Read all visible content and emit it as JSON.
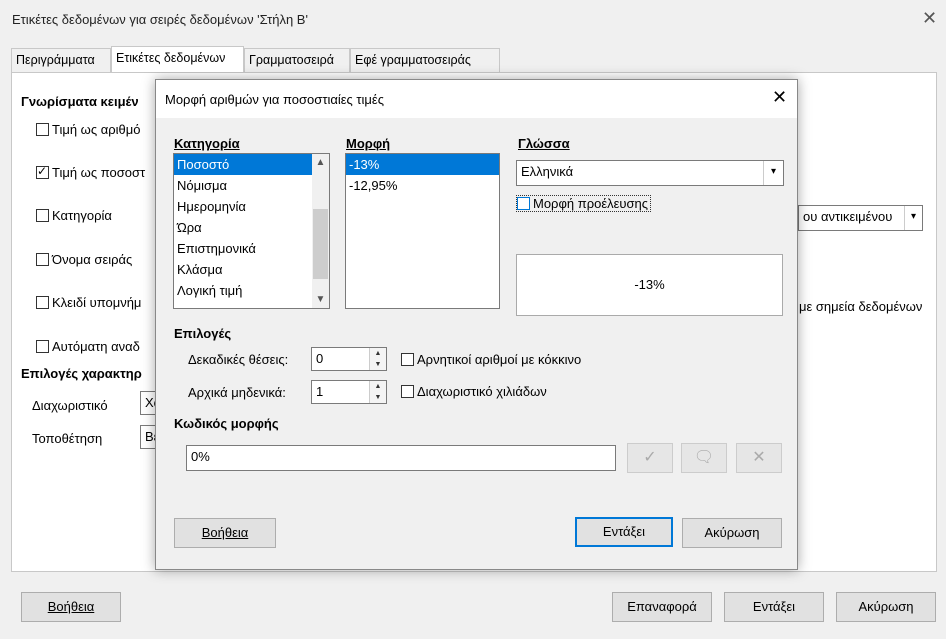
{
  "outer": {
    "title": "Ετικέτες δεδομένων για σειρές δεδομένων 'Στήλη Β'",
    "tabs": [
      "Περιγράμματα",
      "Ετικέτες δεδομένων",
      "Γραμματοσειρά",
      "Εφέ γραμματοσειράς"
    ],
    "section_text_attrs": "Γνωρίσματα κειμέν",
    "checkboxes": [
      {
        "label": "Τιμή ως αριθμό",
        "checked": false
      },
      {
        "label": "Τιμή ως ποσοστ",
        "checked": true
      },
      {
        "label": "Κατηγορία",
        "checked": false
      },
      {
        "label": "Όνομα σειράς",
        "checked": false
      },
      {
        "label": "Κλειδί υπομνήμ",
        "checked": false
      },
      {
        "label": "Αυτόματη αναδ",
        "checked": false
      }
    ],
    "section_text_options": "Επιλογές χαρακτηρ",
    "separator_label": "Διαχωριστικό",
    "separator_value": "Χώ",
    "placement_label": "Τοποθέτηση",
    "placement_value": "Bέ",
    "rotate_value": "ου αντικειμένου",
    "right_text": "με σημεία δεδομένων",
    "buttons": {
      "help": "Βοήθεια",
      "reset": "Επαναφορά",
      "ok": "Εντάξει",
      "cancel": "Ακύρωση"
    }
  },
  "inner": {
    "title": "Μορφή αριθμών για ποσοστιαίες τιμές",
    "category_header": "Κατηγορία",
    "categories": [
      "Ποσοστό",
      "Νόμισμα",
      "Ημερομηνία",
      "Ώρα",
      "Επιστημονικά",
      "Κλάσμα",
      "Λογική τιμή"
    ],
    "format_header": "Μορφή",
    "formats": [
      "-13%",
      "-12,95%"
    ],
    "language_header": "Γλώσσα",
    "language_value": "Ελληνικά",
    "source_format_label": "Μορφή προέλευσης",
    "preview": "-13%",
    "options_header": "Επιλογές",
    "decimal_label": "Δεκαδικές θέσεις:",
    "decimal_value": "0",
    "leading_label": "Αρχικά μηδενικά:",
    "leading_value": "1",
    "negative_red_label": "Αρνητικοί αριθμοί με κόκκινο",
    "thousands_label": "Διαχωριστικό χιλιάδων",
    "format_code_header": "Κωδικός μορφής",
    "format_code_value": "0%",
    "buttons": {
      "help": "Βοήθεια",
      "ok": "Εντάξει",
      "cancel": "Ακύρωση"
    }
  }
}
